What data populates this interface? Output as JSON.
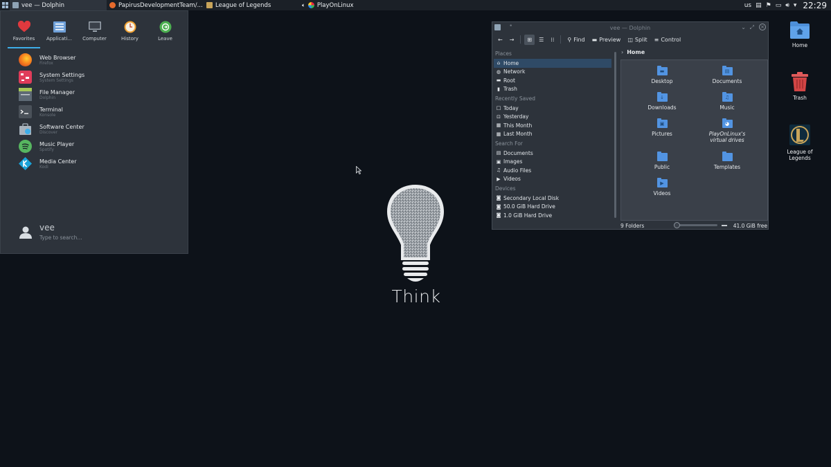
{
  "panel": {
    "tasks": [
      {
        "label": "vee — Dolphin",
        "active": true
      },
      {
        "label": "PapirusDevelopmentTeam/..."
      },
      {
        "label": "League of Legends"
      },
      {
        "label": "PlayOnLinux"
      }
    ],
    "keyboard_layout": "us",
    "clock": "22:29"
  },
  "menu": {
    "tabs": [
      "Favorites",
      "Applicati...",
      "Computer",
      "History",
      "Leave"
    ],
    "active_tab": "Favorites",
    "items": [
      {
        "name": "Web Browser",
        "sub": "Firefox",
        "icon": "firefox-icon"
      },
      {
        "name": "System Settings",
        "sub": "System Settings",
        "icon": "settings-icon"
      },
      {
        "name": "File Manager",
        "sub": "Dolphin",
        "icon": "file-manager-icon"
      },
      {
        "name": "Terminal",
        "sub": "Konsole",
        "icon": "terminal-icon"
      },
      {
        "name": "Software Center",
        "sub": "Discover",
        "icon": "software-center-icon"
      },
      {
        "name": "Music Player",
        "sub": "Spotify",
        "icon": "spotify-icon"
      },
      {
        "name": "Media Center",
        "sub": "Kodi",
        "icon": "kodi-icon"
      }
    ],
    "user": "vee",
    "search_placeholder": "Type to search..."
  },
  "dolphin": {
    "title": "vee — Dolphin",
    "toolbar": {
      "find": "Find",
      "preview": "Preview",
      "split": "Split",
      "control": "Control"
    },
    "places_header": "Places",
    "places": [
      "Home",
      "Network",
      "Root",
      "Trash"
    ],
    "recent_header": "Recently Saved",
    "recent": [
      "Today",
      "Yesterday",
      "This Month",
      "Last Month"
    ],
    "search_header": "Search For",
    "search": [
      "Documents",
      "Images",
      "Audio Files",
      "Videos"
    ],
    "devices_header": "Devices",
    "devices": [
      "Secondary Local Disk",
      "50.0 GiB Hard Drive",
      "1.0 GiB Hard Drive"
    ],
    "breadcrumb": "Home",
    "folders": [
      "Desktop",
      "Documents",
      "Downloads",
      "Music",
      "Pictures",
      "PlayOnLinux's virtual drives",
      "Public",
      "Templates",
      "Videos"
    ],
    "status_count": "9 Folders",
    "status_free": "41.0 GiB free"
  },
  "desktop": {
    "icons": [
      "Home",
      "Trash",
      "League of Legends"
    ]
  },
  "wallpaper": {
    "text": "Think"
  },
  "colors": {
    "accent": "#3daee9",
    "folder": "#5294e2",
    "background": "#0d1219"
  }
}
